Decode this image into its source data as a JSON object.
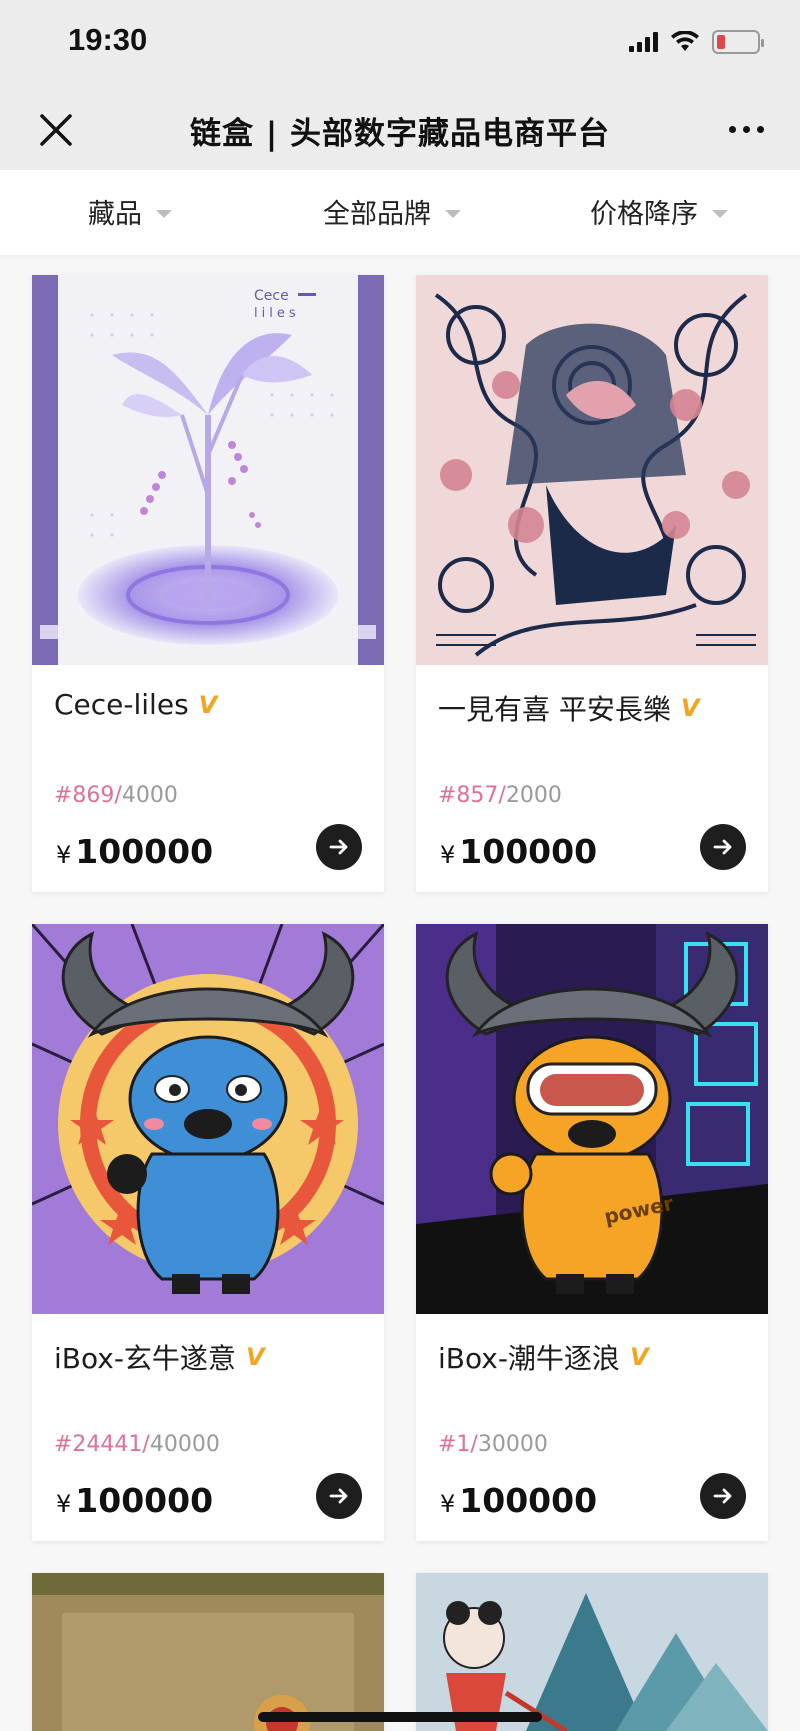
{
  "status": {
    "time": "19:30"
  },
  "nav": {
    "title": "链盒 | 头部数字藏品电商平台"
  },
  "filters": [
    {
      "label": "藏品"
    },
    {
      "label": "全部品牌"
    },
    {
      "label": "价格降序"
    }
  ],
  "cards": [
    {
      "name": "Cece-liles",
      "badge": "V",
      "edition": "#869/",
      "total": "4000",
      "currency": "¥",
      "price": "100000",
      "art_text_1": "Cece",
      "art_text_2": "liles"
    },
    {
      "name": "一見有喜 平安長樂",
      "badge": "V",
      "edition": "#857/",
      "total": "2000",
      "currency": "¥",
      "price": "100000"
    },
    {
      "name": "iBox-玄牛遂意",
      "badge": "V",
      "edition": "#24441/",
      "total": "40000",
      "currency": "¥",
      "price": "100000"
    },
    {
      "name": "iBox-潮牛逐浪",
      "badge": "V",
      "edition": "#1/",
      "total": "30000",
      "currency": "¥",
      "price": "100000",
      "art_text_1": "power"
    },
    {
      "name": "",
      "badge": "",
      "edition": "",
      "total": "",
      "currency": "",
      "price": ""
    },
    {
      "name": "",
      "badge": "",
      "edition": "",
      "total": "",
      "currency": "",
      "price": ""
    }
  ],
  "colors": {
    "edition_number": "#e0709a",
    "edition_total": "#9a9a9a",
    "verified_badge": "#f4a520",
    "header_bg": "#ececec"
  }
}
